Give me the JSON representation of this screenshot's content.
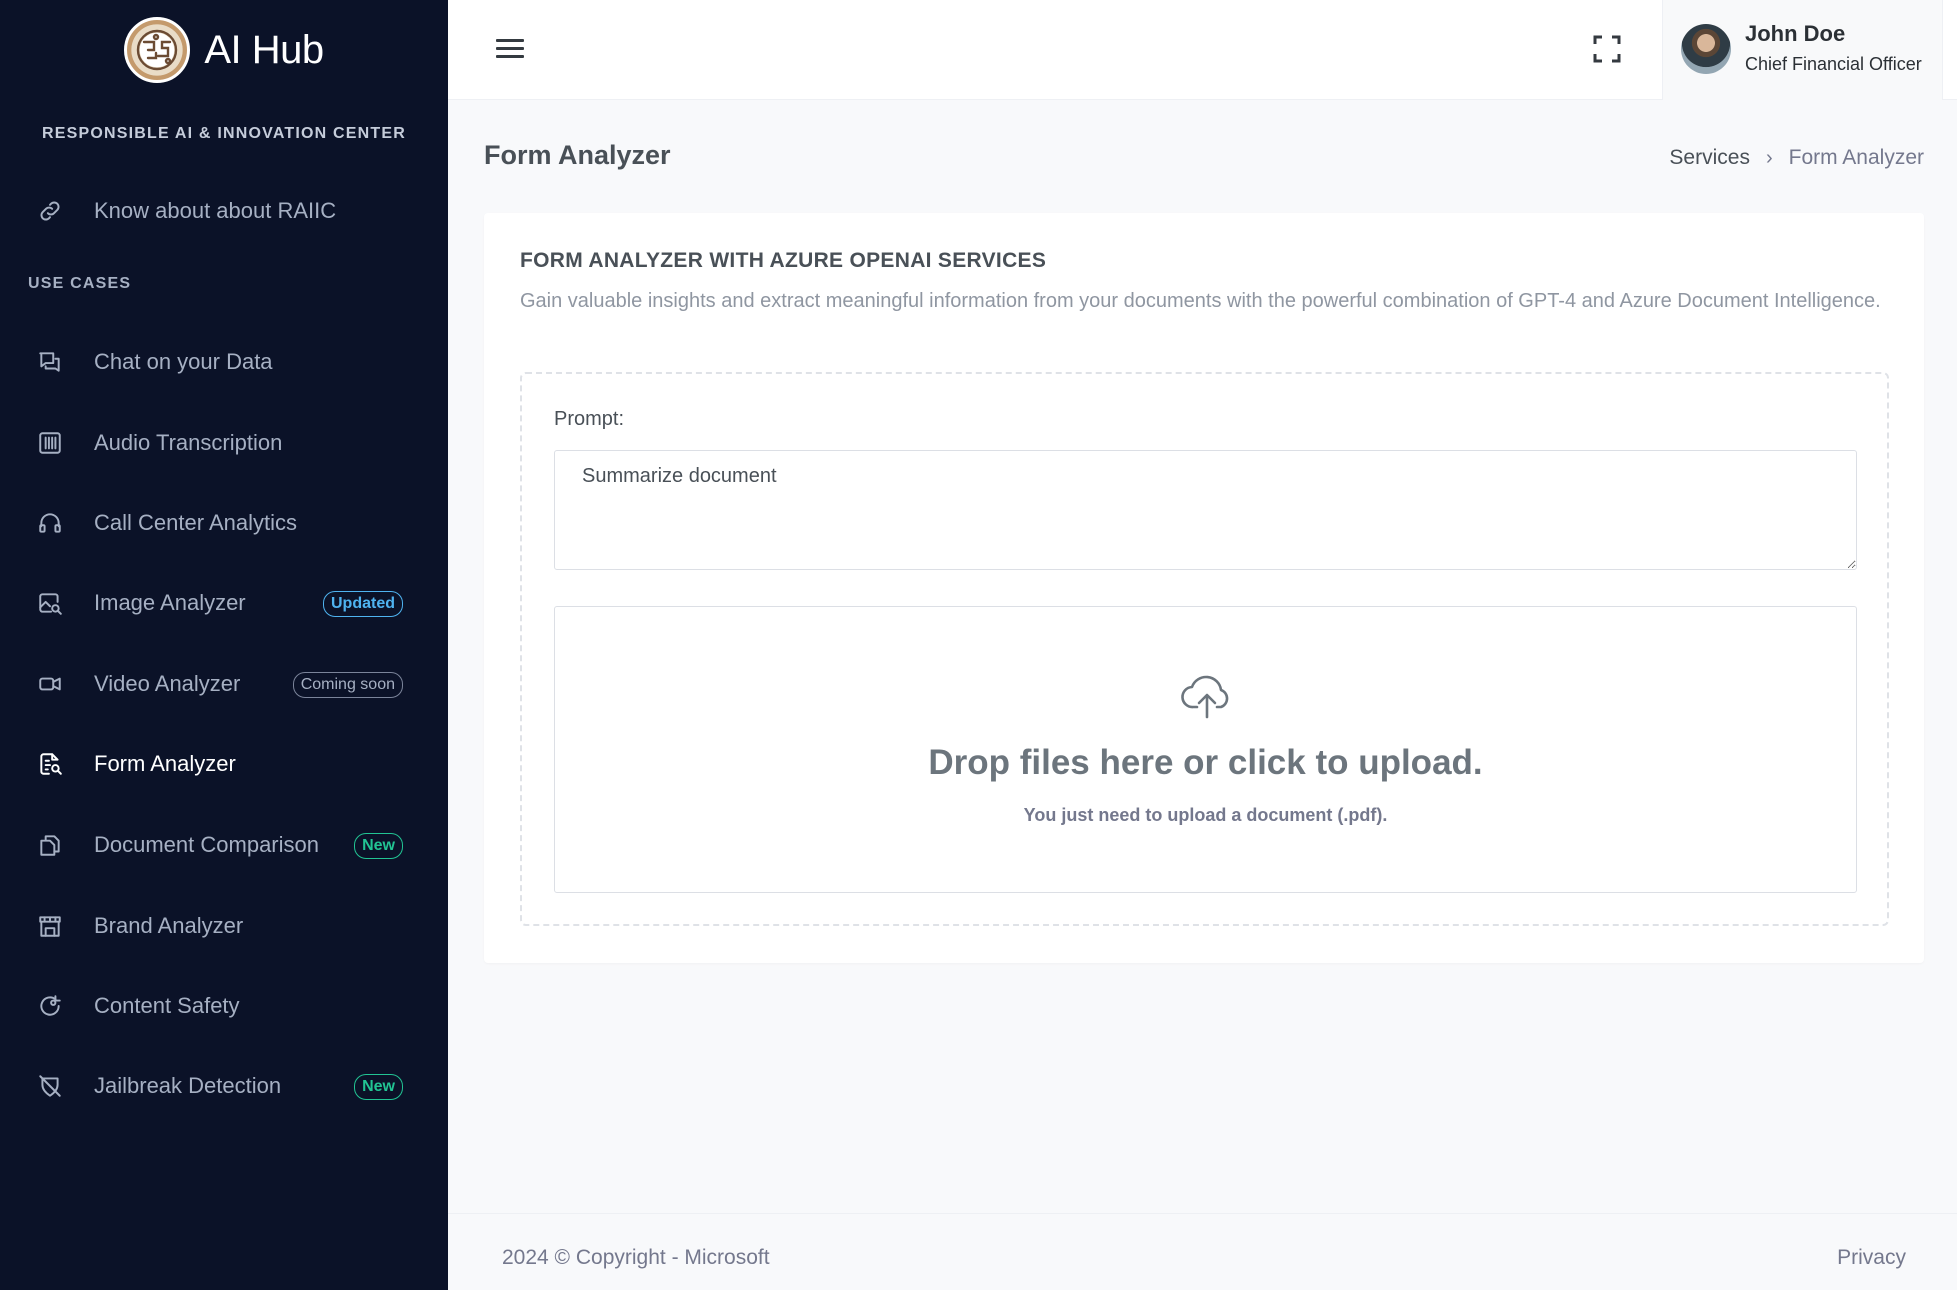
{
  "brand": {
    "name": "AI Hub",
    "subtitle": "RESPONSIBLE AI & INNOVATION CENTER"
  },
  "sidebar": {
    "about_item": {
      "label": "Know about about RAIIC",
      "icon": "link-icon"
    },
    "section_title": "USE CASES",
    "items": [
      {
        "label": "Chat on your Data",
        "icon": "chat-icon",
        "badge": ""
      },
      {
        "label": "Audio Transcription",
        "icon": "waveform-icon",
        "badge": ""
      },
      {
        "label": "Call Center Analytics",
        "icon": "headphones-icon",
        "badge": ""
      },
      {
        "label": "Image Analyzer",
        "icon": "image-search-icon",
        "badge": "Updated"
      },
      {
        "label": "Video Analyzer",
        "icon": "video-icon",
        "badge": "Coming soon"
      },
      {
        "label": "Form Analyzer",
        "icon": "form-search-icon",
        "badge": "",
        "active": true
      },
      {
        "label": "Document Comparison",
        "icon": "copy-icon",
        "badge": "New"
      },
      {
        "label": "Brand Analyzer",
        "icon": "store-icon",
        "badge": ""
      },
      {
        "label": "Content Safety",
        "icon": "shield-refresh-icon",
        "badge": ""
      },
      {
        "label": "Jailbreak Detection",
        "icon": "shield-off-icon",
        "badge": "New"
      }
    ]
  },
  "topbar": {
    "menu_icon": "hamburger-icon",
    "fullscreen_icon": "fullscreen-icon",
    "user": {
      "name": "John Doe",
      "role": "Chief Financial Officer"
    }
  },
  "page": {
    "title": "Form Analyzer",
    "breadcrumb": [
      "Services",
      "Form Analyzer"
    ]
  },
  "card": {
    "title": "FORM ANALYZER WITH AZURE OPENAI SERVICES",
    "description": "Gain valuable insights and extract meaningful information from your documents with the powerful combination of GPT-4 and Azure Document Intelligence.",
    "prompt_label": "Prompt:",
    "prompt_value": "Summarize document",
    "dropzone": {
      "icon": "cloud-upload-icon",
      "title": "Drop files here or click to upload.",
      "hint": "You just need to upload a document (.pdf)."
    }
  },
  "footer": {
    "copyright": "2024 © Copyright - Microsoft",
    "privacy": "Privacy"
  },
  "colors": {
    "sidebar_bg": "#0b1228",
    "badge_updated": "#4fb3f0",
    "badge_new": "#22c493",
    "page_bg": "#f8f9fb"
  }
}
